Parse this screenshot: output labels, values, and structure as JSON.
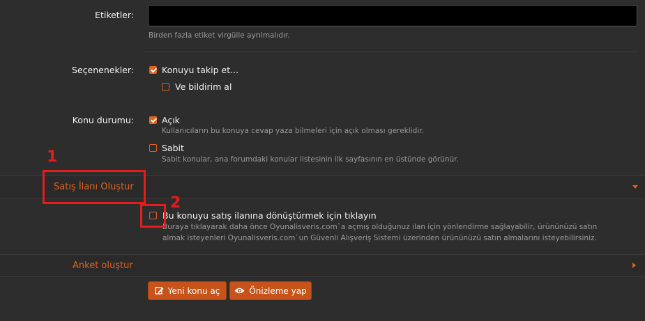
{
  "form": {
    "tags": {
      "label": "Etiketler:",
      "input_value": "",
      "hint": "Birden fazla etiket virgülle ayrılmalıdır."
    },
    "options": {
      "label": "Seçenenekler:",
      "watch_label": "Konuyu takip et...",
      "watch_checked": true,
      "notify_label": "Ve bildirim al",
      "notify_checked": false
    },
    "status": {
      "label": "Konu durumu:",
      "open_label": "Açık",
      "open_checked": true,
      "open_hint": "Kullanıcıların bu konuya cevap yaza bilmeleri için açık olması gereklidir.",
      "sticky_label": "Sabit",
      "sticky_checked": false,
      "sticky_hint": "Sabit konular, ana forumdaki konular listesinin ilk sayfasının en üstünde görünür."
    }
  },
  "sale_section": {
    "title": "Satış İlanı Oluştur",
    "checkbox_label": "Bu konuyu satış ilanına dönüştürmek için tıklayın",
    "checkbox_checked": false,
    "hint_line1": "Buraya tıklayarak daha önce Oyunalisveris.com`a açmış olduğunuz ilan için yönlendirme sağlayabilir, ürününüzü satın",
    "hint_line2": "almak isteyenleri Oyunalisveris.com`un Güvenli Alışveriş Sistemi üzerinden ürününüzü satın almalarını isteyebilirsiniz."
  },
  "poll_section": {
    "title": "Anket oluştur"
  },
  "buttons": {
    "new_topic": "Yeni konu aç",
    "preview": "Önizleme yap"
  },
  "annotations": {
    "marker1": "1",
    "marker2": "2"
  },
  "colors": {
    "accent": "#e0621c",
    "annotation": "#e31d1d",
    "background": "#2d2d2d"
  },
  "icons": {
    "new_topic": "edit-icon",
    "preview": "eye-icon",
    "sale_toggle": "triangle-down-icon",
    "poll_toggle": "triangle-right-icon"
  }
}
